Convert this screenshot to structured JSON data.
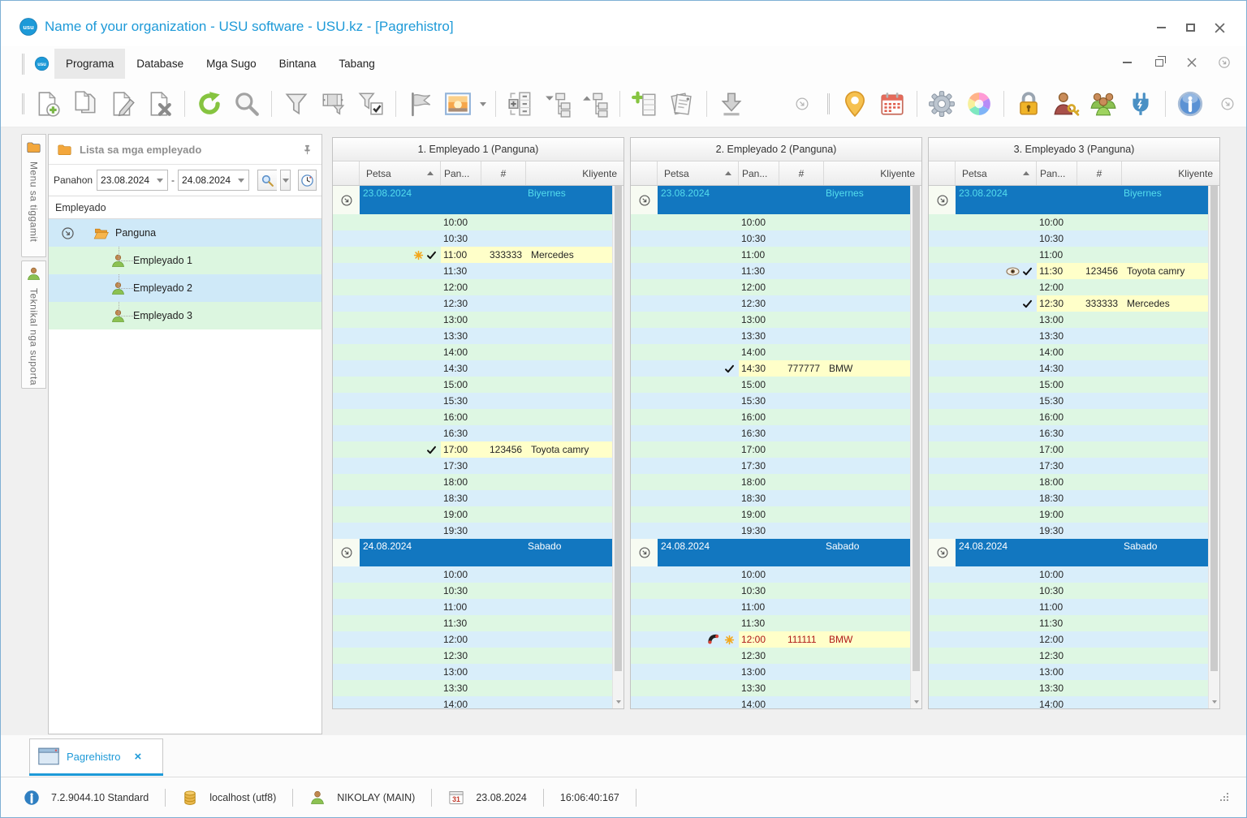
{
  "window": {
    "title": "Name of your organization - USU software - USU.kz - [Pagrehistro]",
    "logo_text": "USU"
  },
  "menu": {
    "items": [
      "Programa",
      "Database",
      "Mga Sugo",
      "Bintana",
      "Tabang"
    ],
    "active_index": 0
  },
  "toolbar": {
    "buttons": [
      "new-document",
      "copy-document",
      "edit-document",
      "delete-document",
      "refresh",
      "search",
      "filter",
      "filter-columns",
      "filter-confirm",
      "flag",
      "image-preview",
      "expand-groups",
      "collapse-tree",
      "expand-tree",
      "add-row",
      "reports",
      "download",
      "overflow",
      "location",
      "calendar",
      "settings",
      "color-wheel",
      "lock",
      "access-key",
      "users",
      "plug",
      "info",
      "overflow"
    ]
  },
  "sidebar": {
    "tabs": [
      "Menu sa tiggamit",
      "Teknikal nga suporta"
    ],
    "panel_title": "Lista sa mga empleyado",
    "period_label": "Panahon",
    "date_from": "23.08.2024",
    "date_to": "24.08.2024",
    "range_dash": "-",
    "tree_header": "Empleyado",
    "tree_root": "Panguna",
    "employees": [
      "Empleyado 1",
      "Empleyado 2",
      "Empleyado 3"
    ]
  },
  "schedule": {
    "columns": {
      "petsa": "Petsa",
      "pan": "Pan...",
      "num": "#",
      "kliyente": "Kliyente"
    },
    "days": [
      {
        "date": "23.08.2024",
        "weekday": "Biyernes",
        "times": [
          "10:00",
          "10:30",
          "11:00",
          "11:30",
          "12:00",
          "12:30",
          "13:00",
          "13:30",
          "14:00",
          "14:30",
          "15:00",
          "15:30",
          "16:00",
          "16:30",
          "17:00",
          "17:30",
          "18:00",
          "18:30",
          "19:00",
          "19:30"
        ]
      },
      {
        "date": "24.08.2024",
        "weekday": "Sabado",
        "times": [
          "10:00",
          "10:30",
          "11:00",
          "11:30",
          "12:00",
          "12:30",
          "13:00",
          "13:30",
          "14:00"
        ]
      }
    ],
    "panels": [
      {
        "title": "1. Empleyado 1 (Panguna)",
        "appointments": [
          {
            "day": 0,
            "time": "11:00",
            "number": "333333",
            "client": "Mercedes",
            "icons": [
              "asterisk",
              "check"
            ],
            "text_color": "black"
          },
          {
            "day": 0,
            "time": "17:00",
            "number": "123456",
            "client": "Toyota camry",
            "icons": [
              "check"
            ],
            "text_color": "black"
          }
        ]
      },
      {
        "title": "2. Empleyado 2 (Panguna)",
        "appointments": [
          {
            "day": 0,
            "time": "14:30",
            "number": "777777",
            "client": "BMW",
            "icons": [
              "check"
            ],
            "text_color": "black"
          },
          {
            "day": 1,
            "time": "12:00",
            "number": "111111",
            "client": "BMW",
            "icons": [
              "phone",
              "asterisk"
            ],
            "text_color": "red"
          }
        ]
      },
      {
        "title": "3. Empleyado 3 (Panguna)",
        "appointments": [
          {
            "day": 0,
            "time": "11:30",
            "number": "123456",
            "client": "Toyota camry",
            "icons": [
              "eye",
              "check"
            ],
            "text_color": "black"
          },
          {
            "day": 0,
            "time": "12:30",
            "number": "333333",
            "client": "Mercedes",
            "icons": [
              "check"
            ],
            "text_color": "black"
          }
        ]
      }
    ]
  },
  "tabs": {
    "items": [
      {
        "label": "Pagrehistro",
        "active": true
      }
    ],
    "close_glyph": "×"
  },
  "statusbar": {
    "version": "7.2.9044.10 Standard",
    "database": "localhost (utf8)",
    "user": "NIKOLAY (MAIN)",
    "date": "23.08.2024",
    "time": "16:06:40:167",
    "calendar_day": "31"
  },
  "colors": {
    "accent": "#1e9ad8",
    "date_row": "#1277c0",
    "row_green": "#def7e3",
    "row_blue": "#d9eefa",
    "highlight": "#ffffc9",
    "alert_text": "#b01818"
  }
}
